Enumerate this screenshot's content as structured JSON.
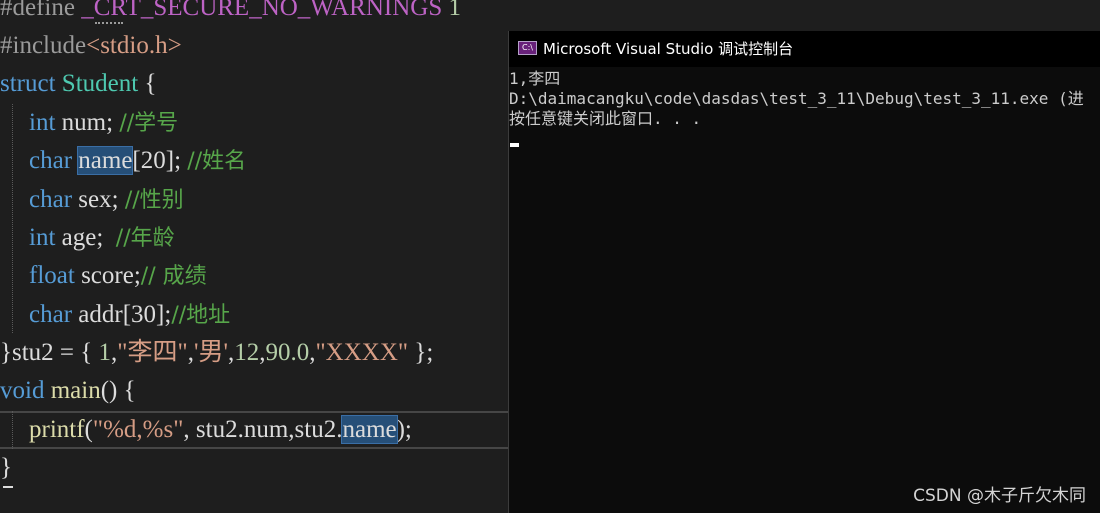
{
  "editor": {
    "lines": {
      "l1": {
        "directive": "#define ",
        "macro": "_CRT_SECURE_NO_WARNINGS",
        "value": " 1"
      },
      "l2": {
        "directive": "#include",
        "header": "<stdio.h>"
      },
      "l3": {
        "kw": "struct ",
        "type": "Student",
        "rest": " {"
      },
      "l4": {
        "kw": "int",
        "code": " num; ",
        "comment": "//学号"
      },
      "l5": {
        "kw": "char ",
        "sel": "name",
        "code": "[20]; ",
        "comment": "//姓名"
      },
      "l6": {
        "kw": "char",
        "code": " sex; ",
        "comment": "//性别"
      },
      "l7": {
        "kw": "int",
        "code": " age;  ",
        "comment": "//年龄"
      },
      "l8": {
        "kw": "float",
        "code": " score;",
        "comment": "// 成绩"
      },
      "l9": {
        "kw": "char",
        "code": " addr[30];",
        "comment": "//地址"
      },
      "l10": {
        "p1": "}stu2 = { ",
        "n1": "1",
        "c1": ",",
        "s1": "\"李四\"",
        "c2": ",",
        "s2": "'男'",
        "c3": ",",
        "n2": "12",
        "c4": ",",
        "n3": "90.0",
        "c5": ",",
        "s3": "\"XXXX\"",
        "p2": " };"
      },
      "l11": {
        "kw": "void ",
        "fn": "main",
        "rest": "() {"
      },
      "l12": {
        "fn": "printf",
        "p1": "(",
        "str": "\"%d,%s\"",
        "code": ", stu2.num,stu2.",
        "sel": "name",
        "p2": ");"
      },
      "l13": {
        "text": "}"
      }
    }
  },
  "console": {
    "title": "Microsoft Visual Studio 调试控制台",
    "icon_name": "console-app-icon",
    "icon_text": "C:\\",
    "lines": [
      "1,李四",
      "D:\\daimacangku\\code\\dasdas\\test_3_11\\Debug\\test_3_11.exe (进",
      "按任意键关闭此窗口. . ."
    ]
  },
  "watermark": "CSDN @木子斤欠木同",
  "colors": {
    "background": "#1e1e1e",
    "keyword": "#569cd6",
    "type": "#4ec9b0",
    "string": "#d69d85",
    "comment": "#57a64a",
    "macro": "#bd63c5",
    "console_bg": "#0c0c0c"
  }
}
